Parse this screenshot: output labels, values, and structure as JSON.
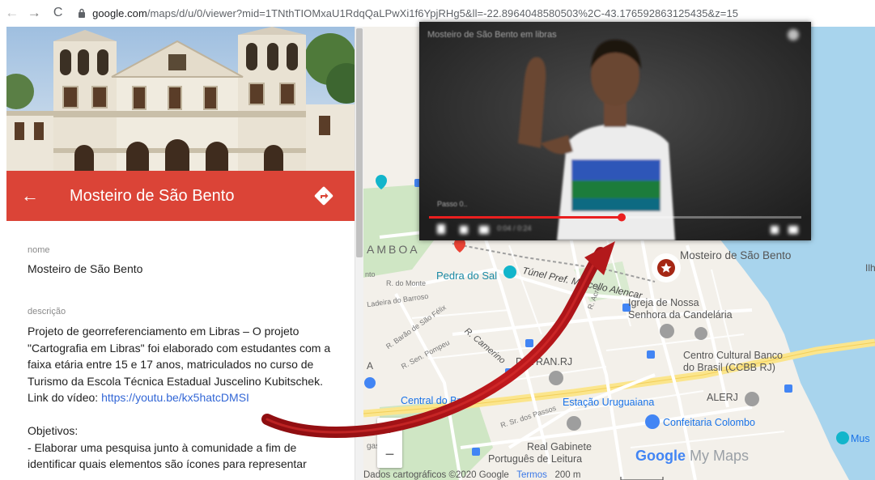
{
  "browser": {
    "url_host": "google.com",
    "url_rest": "/maps/d/u/0/viewer?mid=1TNthTIOMxaU1RdqQaLPwXi1f6YpjRHg5&ll=-22.8964048580503%2C-43.176592863125435&z=15"
  },
  "panel": {
    "title": "Mosteiro de São Bento",
    "name_label": "nome",
    "name_value": "Mosteiro de São Bento",
    "desc_label": "descrição",
    "desc_text": "Projeto de georreferenciamento em Libras – O projeto \"Cartografia em Libras\" foi elaborado com estudantes com a faixa etária entre 15 e 17 anos, matriculados no curso de Turismo da Escola Técnica Estadual Juscelino Kubitschek.",
    "video_prefix": "Link do vídeo: ",
    "video_link": "https://youtu.be/kx5hatcDMSI",
    "objectives_title": "Objetivos:",
    "objective_1": "- Elaborar uma pesquisa junto à comunidade a fim de",
    "objective_2": "identificar quais elementos são ícones para representar"
  },
  "map": {
    "labels": {
      "mosteiro": "Mosteiro de São Bento",
      "pedra": "Pedra do Sal",
      "tunel": "Túnel Pref. Marcello Alencar",
      "candelaria_1": "Igreja de Nossa",
      "candelaria_2": "Senhora da Candelária",
      "ccbb_1": "Centro Cultural Banco",
      "ccbb_2": "do Brasil (CCBB RJ)",
      "detran": "DETRAN.RJ",
      "central": "Central do Brasil",
      "uruguaiana": "Estação Uruguaiana",
      "alerj": "ALERJ",
      "colombo": "Confeitaria Colombo",
      "gabinete_1": "Real Gabinete",
      "gabinete_2": "Português de Leitura",
      "gamboa": "AMBOA",
      "musa": "Mus",
      "ilha": "Ilh",
      "r_monte": "R. do Monte",
      "ladeira": "Ladeira do Barroso",
      "camerino": "R. Camerino",
      "barao": "R. Barão de São Félix",
      "senpompeu": "R. Sen. Pompeu",
      "acre": "R. Acre",
      "sete_setembro": "R. Sr. dos Passos",
      "gas": "gas",
      "nto": "nto",
      "a_letter": "A"
    },
    "footer_data": "Dados cartográficos ©2020 Google",
    "footer_terms": "Termos",
    "footer_scale": "200 m",
    "brand_google": "Google",
    "brand_mymaps": "My Maps"
  },
  "video": {
    "title": "Mosteiro de São Bento em libras",
    "subtitle": "Passo 0..",
    "time": "0:04 / 0:24"
  },
  "colors": {
    "header_red": "#db4437",
    "link_blue": "#3367d6",
    "water": "#a8d4ed",
    "arrow_red": "#b3191b"
  }
}
